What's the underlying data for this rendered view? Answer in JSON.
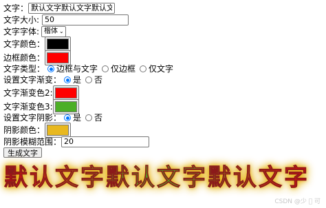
{
  "form": {
    "text_label": "文字：",
    "text_value": "默认文字默认文字默认文字",
    "font_size_label": "文字大小:",
    "font_size_value": "50",
    "font_family_label": "文字字体:",
    "font_family_value": "楷体",
    "font_color_label": "文字颜色：",
    "font_color": "#000000",
    "border_color_label": "边框颜色：",
    "border_color": "#ff0000",
    "text_type_label": "文字类型：",
    "text_type_options": [
      "边框与文字",
      "仅边框",
      "仅文字"
    ],
    "gradient_label": "设置文字渐变：",
    "gradient_options": [
      "是",
      "否"
    ],
    "gradient_color2_label": "文字渐变色2:",
    "gradient_color2": "#ff0000",
    "gradient_color3_label": "文字渐变色3:",
    "gradient_color3": "#4caf26",
    "shadow_label": "设置文字阴影：",
    "shadow_options": [
      "是",
      "否"
    ],
    "shadow_color_label": "阴影颜色：",
    "shadow_color": "#e8b81f",
    "shadow_blur_label": "阴影模糊范围：",
    "shadow_blur_value": "20",
    "generate_button": "生成文字"
  },
  "preview": {
    "text": "默认文字默认文字默认文字"
  },
  "watermark": "CSDN @少 ゙ 可"
}
